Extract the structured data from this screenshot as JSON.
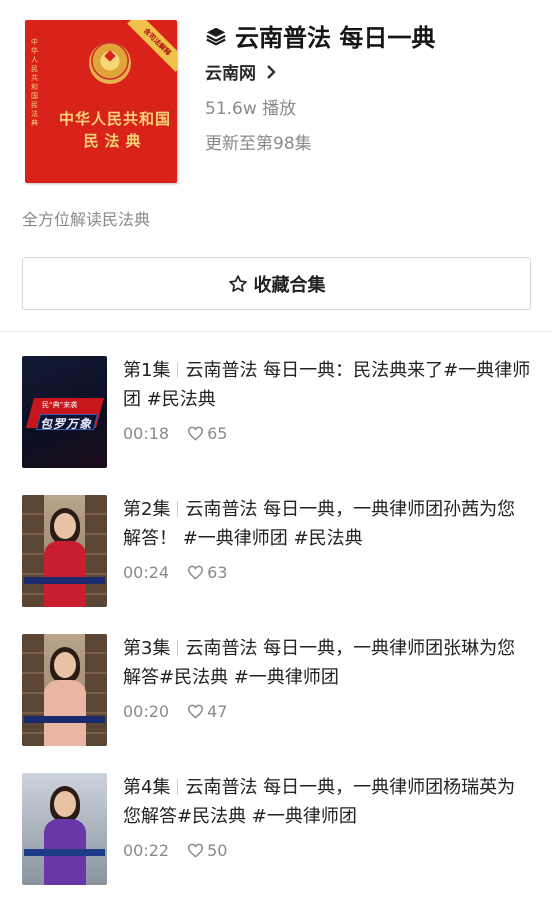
{
  "collection": {
    "title": "云南普法 每日一典",
    "author": "云南网",
    "plays": "51.6w 播放",
    "updated": "更新至第98集",
    "description": "全方位解读民法典",
    "favorite_label": "收藏合集"
  },
  "cover": {
    "spine_text": "中华人民共和国民法典",
    "title_line1": "中华人民共和国",
    "title_line2": "民法典",
    "ribbon": "含司法解释"
  },
  "episodes": [
    {
      "episode": "第1集",
      "title": "云南普法 每日一典：民法典来了#一典律师团 #民法典",
      "duration": "00:18",
      "likes": "65",
      "thumb_small": "民“典”来袭",
      "thumb_big": "包罗万象"
    },
    {
      "episode": "第2集",
      "title": "云南普法 每日一典，一典律师团孙茜为您解答！ #一典律师团 #民法典",
      "duration": "00:24",
      "likes": "63"
    },
    {
      "episode": "第3集",
      "title": "云南普法 每日一典，一典律师团张琳为您解答#民法典 #一典律师团",
      "duration": "00:20",
      "likes": "47"
    },
    {
      "episode": "第4集",
      "title": "云南普法 每日一典，一典律师团杨瑞英为您解答#民法典 #一典律师团",
      "duration": "00:22",
      "likes": "50"
    }
  ],
  "colors": {
    "cover_red": "#d9231a",
    "gold": "#f6d27a",
    "muted_text": "#8a8a8a"
  },
  "icons": {
    "collection": "layers-icon",
    "author_link": "chevron-right-icon",
    "favorite": "star-outline-icon",
    "likes": "heart-outline-icon"
  }
}
